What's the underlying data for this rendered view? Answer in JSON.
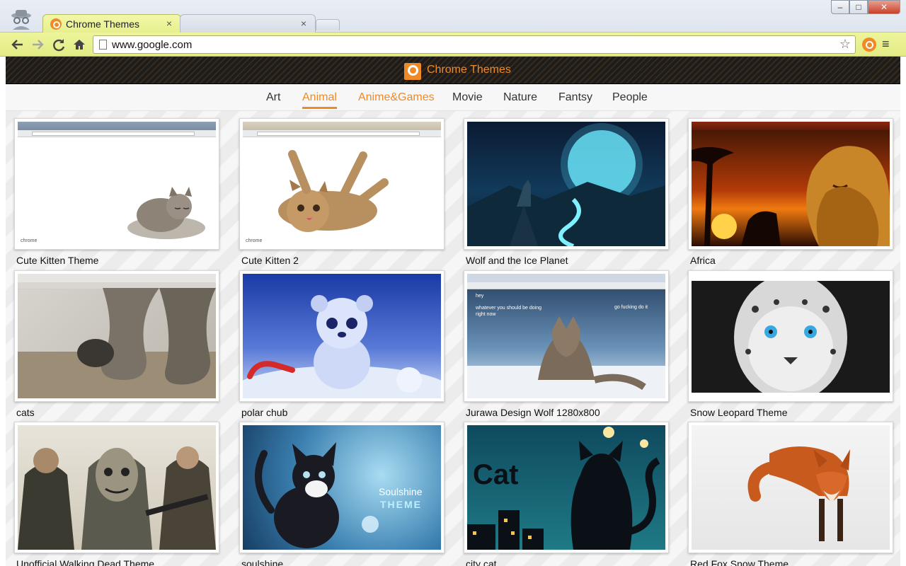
{
  "browser": {
    "tabs": [
      {
        "title": "Chrome Themes",
        "active": true
      },
      {
        "title": "",
        "active": false
      }
    ],
    "close_glyph": "×",
    "url": "www.google.com",
    "controls": {
      "minimize": "–",
      "maximize": "□",
      "close": "✕"
    },
    "toolbar_icons": [
      "back-arrow-icon",
      "forward-arrow-icon",
      "reload-icon",
      "home-icon",
      "star-icon",
      "extension-icon",
      "menu-icon"
    ],
    "accent": "#e7f08e"
  },
  "site": {
    "logo_text": "Chrome Themes",
    "brand_color": "#f08a24",
    "categories": [
      "Art",
      "Animal",
      "Anime&Games",
      "Movie",
      "Nature",
      "Fantsy",
      "People"
    ],
    "active_category": "Animal",
    "hover_category": "Anime&Games",
    "themes": [
      {
        "title": "Cute Kitten Theme"
      },
      {
        "title": "Cute Kitten 2"
      },
      {
        "title": "Wolf and the Ice Planet"
      },
      {
        "title": "Africa"
      },
      {
        "title": "cats"
      },
      {
        "title": "polar chub"
      },
      {
        "title": "Jurawa Design Wolf 1280x800"
      },
      {
        "title": "Snow Leopard Theme"
      },
      {
        "title": "Unofficial Walking Dead Theme"
      },
      {
        "title": "soulshine"
      },
      {
        "title": "city cat"
      },
      {
        "title": "Red Fox Snow Theme"
      }
    ],
    "thumb_text": {
      "wolf_hey": "hey",
      "wolf_left": "whatever you should be doing right now",
      "wolf_right": "go fucking do it",
      "soulshine_1": "Soulshine",
      "soulshine_2": "THEME",
      "citycat": "Cat",
      "chrome_label": "chrome"
    }
  }
}
